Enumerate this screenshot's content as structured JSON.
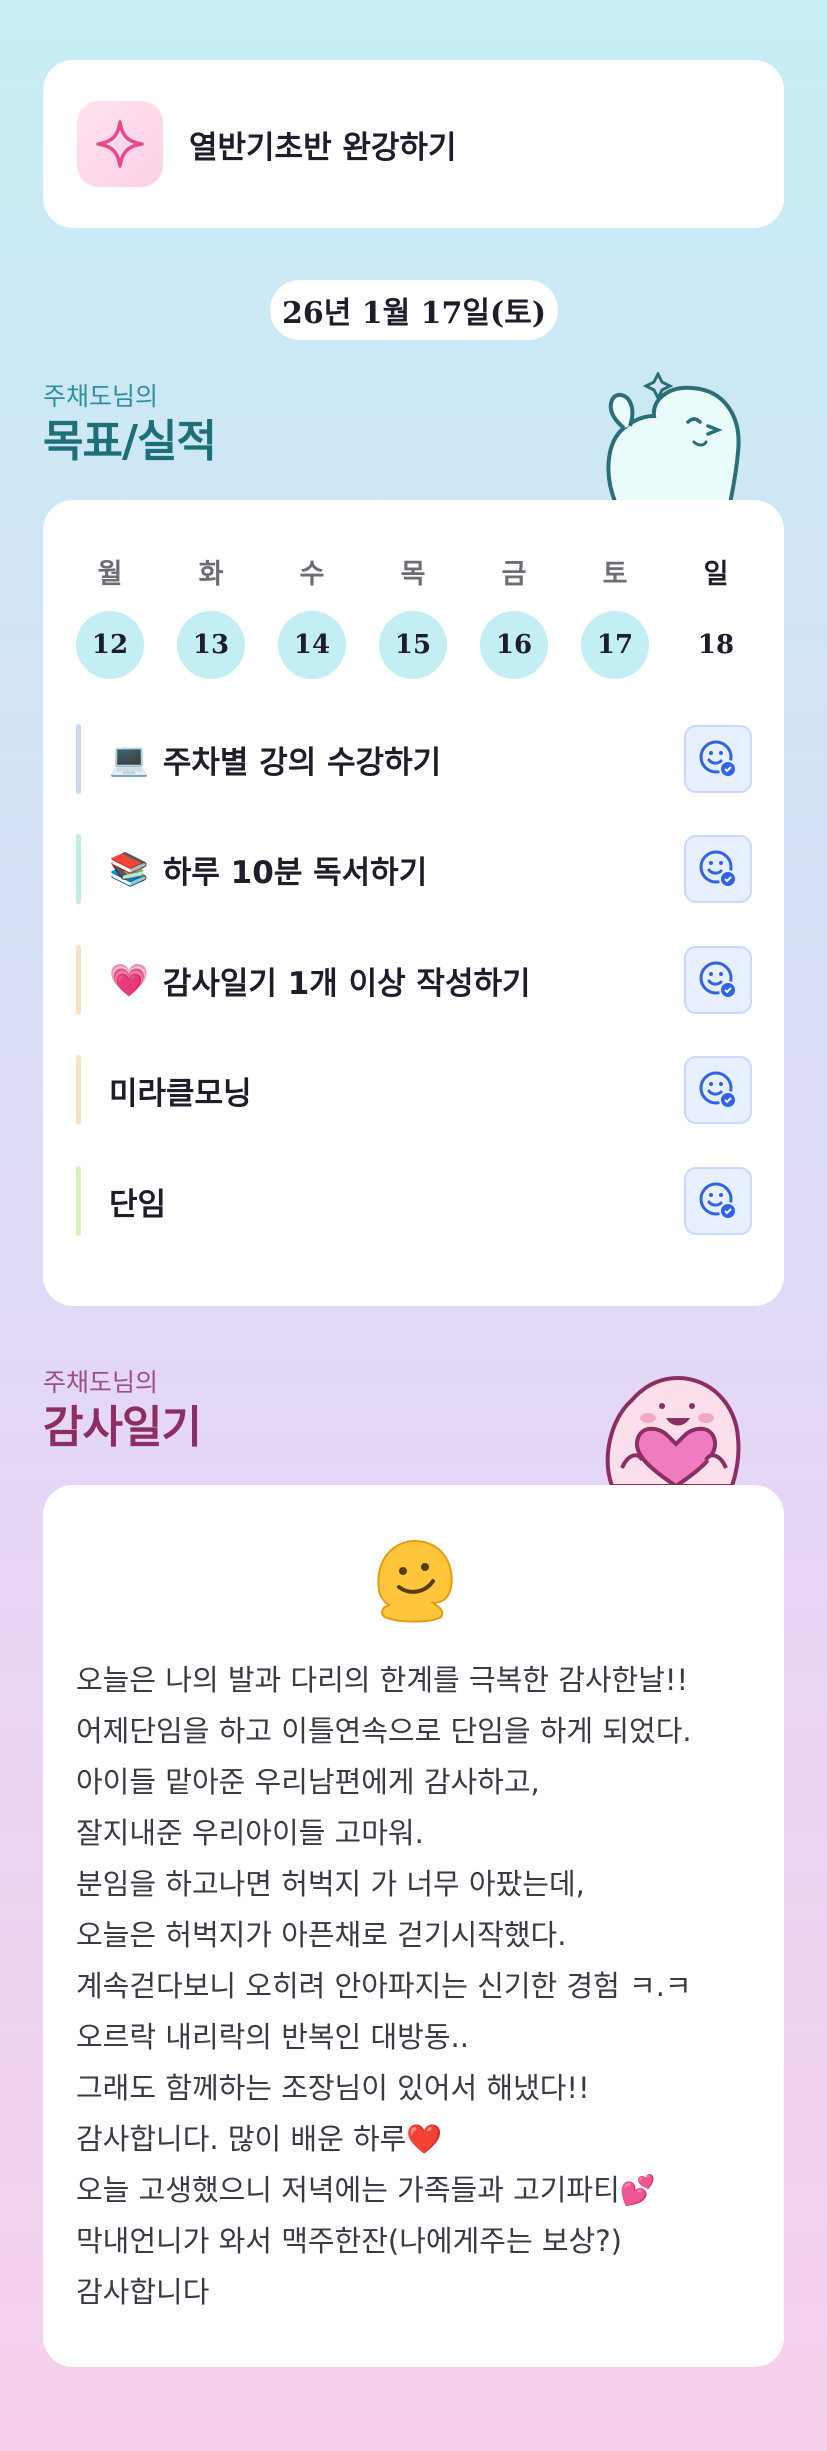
{
  "goal_card": {
    "title": "열반기초반 완강하기",
    "icon": "sparkle-icon"
  },
  "date": "26년 1월 17일(토)",
  "goals_section": {
    "subtitle": "주채도님의",
    "title": "목표/실적"
  },
  "week": {
    "days": [
      "월",
      "화",
      "수",
      "목",
      "금",
      "토",
      "일"
    ],
    "dates": [
      "12",
      "13",
      "14",
      "15",
      "16",
      "17",
      "18"
    ],
    "completed": [
      true,
      true,
      true,
      true,
      true,
      true,
      false
    ]
  },
  "goals": [
    {
      "emoji": "💻",
      "label": "주차별 강의 수강하기",
      "bar_color": "#cfd8ea"
    },
    {
      "emoji": "📚",
      "label": "하루 10분 독서하기",
      "bar_color": "#bfeedd"
    },
    {
      "emoji": "💗",
      "label": "감사일기 1개 이상 작성하기",
      "bar_color": "#f9e2c4"
    },
    {
      "emoji": "",
      "label": "미라클모닝",
      "bar_color": "#f9e2c4"
    },
    {
      "emoji": "",
      "label": "단임",
      "bar_color": "#d8f2b8"
    }
  ],
  "gratitude_section": {
    "subtitle": "주채도님의",
    "title": "감사일기"
  },
  "gratitude": {
    "emoji_icon": "melting-face-icon",
    "lines": [
      "오늘은 나의 발과 다리의 한계를 극복한 감사한날!!",
      "어제단임을 하고 이틀연속으로 단임을 하게 되었다.",
      "아이들 맡아준 우리남편에게 감사하고,",
      "잘지내준 우리아이들 고마워.",
      "분임을 하고나면 허벅지 가 너무 아팠는데,",
      "오늘은 허벅지가 아픈채로 걷기시작했다.",
      "계속걷다보니 오히려 안아파지는 신기한 경험 ㅋ.ㅋ",
      "오르락 내리락의 반복인 대방동..",
      "그래도 함께하는 조장님이 있어서 해냈다!!",
      "감사합니다. 많이 배운 하루❤️",
      "오늘 고생했으니 저녁에는 가족들과 고기파티💕",
      "막내언니가 와서 맥주한잔(나에게주는 보상?)",
      "감사합니다"
    ]
  },
  "colors": {
    "accent_teal": "#1d6f78",
    "accent_plum": "#8c2e63",
    "date_circle": "#c3eef3",
    "check_button": "#e8efff"
  }
}
